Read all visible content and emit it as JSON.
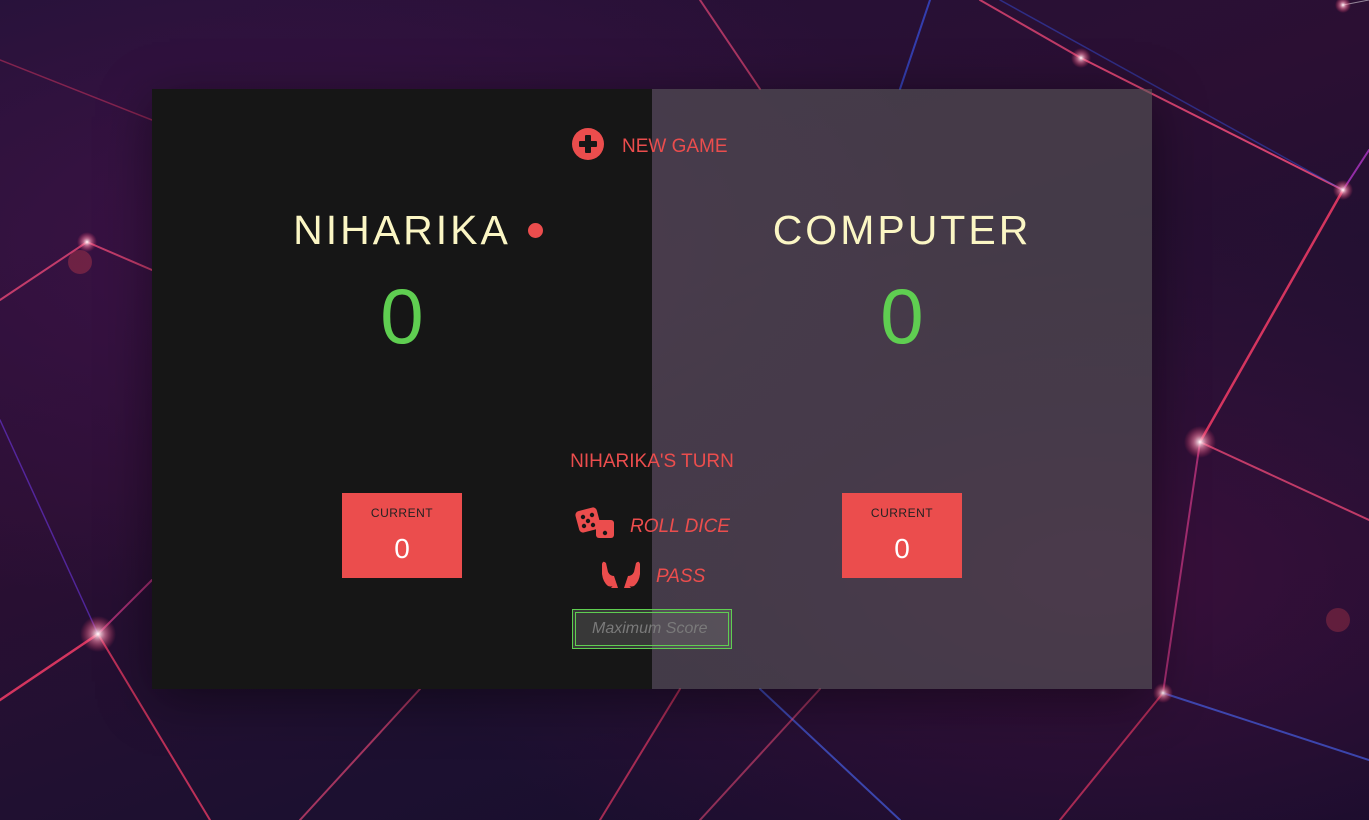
{
  "game": {
    "new_game_label": "NEW GAME",
    "turn_text": "NIHARIKA'S TURN",
    "roll_label": "ROLL DICE",
    "pass_label": "PASS",
    "max_score_placeholder": "Maximum Score",
    "max_score_value": ""
  },
  "players": [
    {
      "name": "NIHARIKA",
      "score": "0",
      "current_label": "CURRENT",
      "current": "0",
      "active": true
    },
    {
      "name": "COMPUTER",
      "score": "0",
      "current_label": "CURRENT",
      "current": "0",
      "active": false
    }
  ],
  "icons": {
    "new_game": "plus-circle-icon",
    "roll": "dice-icon",
    "pass": "hands-icon",
    "active": "active-dot-icon"
  },
  "colors": {
    "accent": "#eb4d4d",
    "score": "#5fce51",
    "name": "#fbf6c4",
    "panel_active": "#161616",
    "panel_inactive": "#555555"
  }
}
